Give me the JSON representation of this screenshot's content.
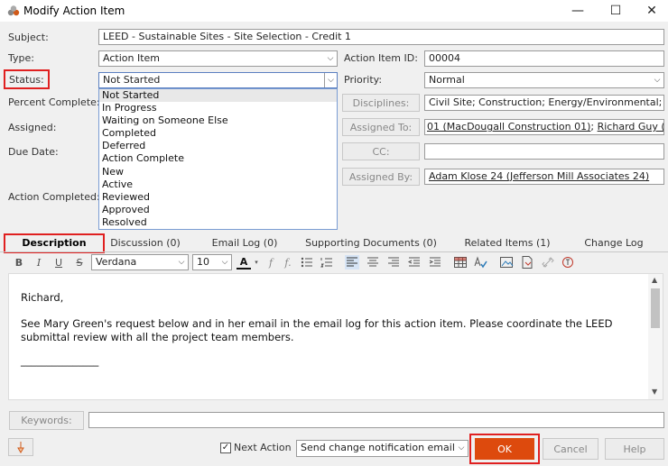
{
  "window": {
    "title": "Modify Action Item",
    "minimize": "—",
    "maximize": "☐",
    "close": "✕"
  },
  "form": {
    "subject_label": "Subject:",
    "subject_value": "LEED - Sustainable Sites - Site Selection - Credit 1",
    "type_label": "Type:",
    "type_value": "Action Item",
    "status_label": "Status:",
    "status_value": "Not Started",
    "percent_label": "Percent Complete:",
    "assigned_label": "Assigned:",
    "due_label": "Due Date:",
    "action_completed_label": "Action Completed:",
    "action_id_label": "Action Item ID:",
    "action_id_value": "00004",
    "priority_label": "Priority:",
    "priority_value": "Normal",
    "disciplines_button": "Disciplines:",
    "disciplines_value": "Civil Site; Construction; Energy/Environmental;",
    "assigned_to_button": "Assigned To:",
    "assigned_to_value_1": "01 (MacDougall Construction 01)",
    "assigned_to_value_2": "Richard Guy (Guy",
    "cc_button": "CC:",
    "cc_value": "",
    "assigned_by_button": "Assigned By:",
    "assigned_by_value": "Adam Klose 24 (Jefferson Mill Associates 24)"
  },
  "status_options": [
    "Not Started",
    "In Progress",
    "Waiting on Someone Else",
    "Completed",
    "Deferred",
    "Action Complete",
    "New",
    "Active",
    "Reviewed",
    "Approved",
    "Resolved"
  ],
  "tabs": [
    "Description",
    "Discussion (0)",
    "Email Log (0)",
    "Supporting Documents (0)",
    "Related Items (1)",
    "Change Log"
  ],
  "toolbar": {
    "bold": "B",
    "italic": "I",
    "underline": "U",
    "strike": "S",
    "font_value": "Verdana",
    "size_value": "10",
    "font_color": "A"
  },
  "editor": {
    "line1": "Richard,",
    "line2": "See Mary Green's request below and in her email in the email log for this action item.  Please coordinate the LEED",
    "line3": "submittal review with all the project team members.",
    "rule": "_______________"
  },
  "footer": {
    "keywords_button": "Keywords:",
    "keywords_value": "",
    "next_action_label": "Next Action",
    "notification_value": "Send change notification email",
    "ok": "OK",
    "cancel": "Cancel",
    "help": "Help"
  },
  "colors": {
    "accent_ok": "#dd4a0d",
    "highlight_box": "#e02020"
  }
}
